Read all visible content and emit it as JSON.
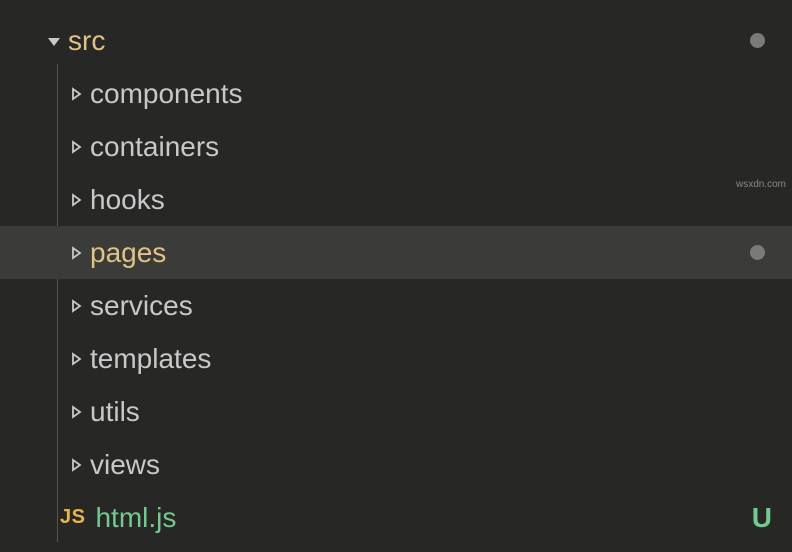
{
  "tree": {
    "root": {
      "label": "src",
      "expanded": true,
      "modified": true
    },
    "children": [
      {
        "label": "components",
        "expanded": false,
        "modified": false,
        "selected": false
      },
      {
        "label": "containers",
        "expanded": false,
        "modified": false,
        "selected": false
      },
      {
        "label": "hooks",
        "expanded": false,
        "modified": false,
        "selected": false
      },
      {
        "label": "pages",
        "expanded": false,
        "modified": true,
        "selected": true
      },
      {
        "label": "services",
        "expanded": false,
        "modified": false,
        "selected": false
      },
      {
        "label": "templates",
        "expanded": false,
        "modified": false,
        "selected": false
      },
      {
        "label": "utils",
        "expanded": false,
        "modified": false,
        "selected": false
      },
      {
        "label": "views",
        "expanded": false,
        "modified": false,
        "selected": false
      }
    ],
    "file": {
      "label": "html.js",
      "icon_text": "JS",
      "git_status": "U"
    }
  },
  "watermark": "wsxdn.com"
}
